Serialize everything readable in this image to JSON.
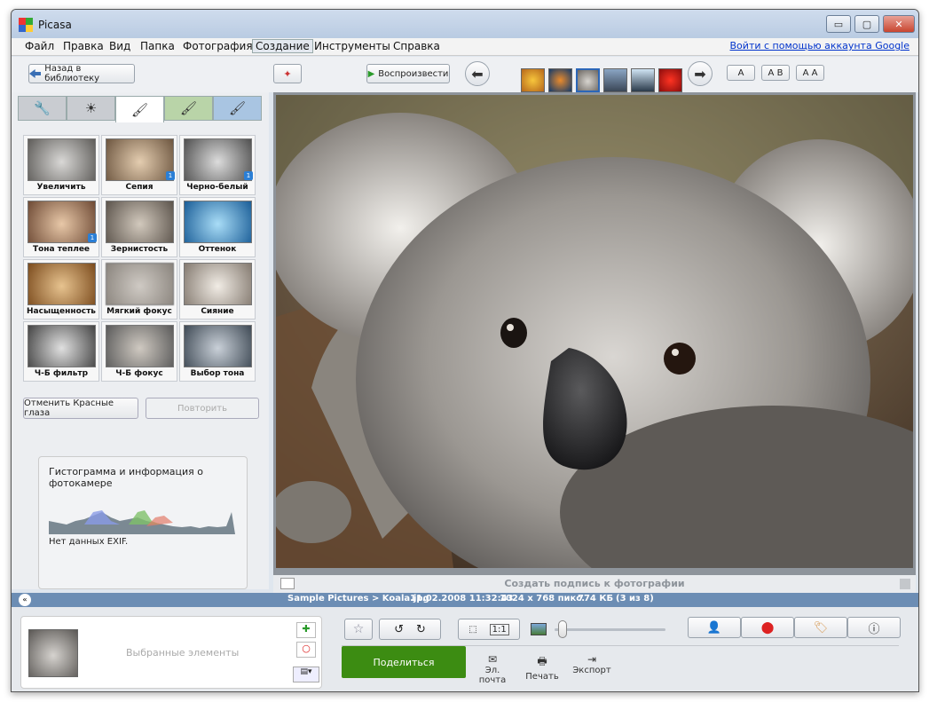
{
  "window": {
    "title": "Picasa",
    "minimize": "▭",
    "maximize": "▢",
    "close": "✕"
  },
  "menu": {
    "items": [
      "Файл",
      "Правка",
      "Вид",
      "Папка",
      "Фотография",
      "Создание",
      "Инструменты",
      "Справка"
    ],
    "active_index": 5,
    "signin": "Войти с помощью аккаунта Google"
  },
  "toolbar": {
    "back": "Назад в библиотеку",
    "play": "Воспроизвести",
    "text_buttons": [
      "A",
      "A B",
      "A A"
    ]
  },
  "tabs": {
    "icons": [
      "wrench-icon",
      "sun-icon",
      "brush-icon",
      "green-brush-icon",
      "blue-brush-icon"
    ],
    "glyphs": [
      "🔧",
      "☀",
      "🖌",
      "🖌",
      "🖌"
    ],
    "active_index": 2
  },
  "effects": [
    {
      "label": "Увеличить резкость",
      "badge": ""
    },
    {
      "label": "Сепия",
      "badge": "1"
    },
    {
      "label": "Черно-белый",
      "badge": "1"
    },
    {
      "label": "Тона теплее",
      "badge": "1"
    },
    {
      "label": "Зернистость",
      "badge": ""
    },
    {
      "label": "Оттенок",
      "badge": ""
    },
    {
      "label": "Насыщенность",
      "badge": ""
    },
    {
      "label": "Мягкий фокус",
      "badge": ""
    },
    {
      "label": "Сияние",
      "badge": ""
    },
    {
      "label": "Ч-Б фильтр",
      "badge": ""
    },
    {
      "label": "Ч-Б фокус",
      "badge": ""
    },
    {
      "label": "Выбор тона",
      "badge": ""
    }
  ],
  "actions": {
    "undo": "Отменить Красные глаза",
    "redo": "Повторить"
  },
  "histogram": {
    "title": "Гистограмма и информация о фотокамере",
    "exif": "Нет данных EXIF."
  },
  "caption": {
    "placeholder": "Создать подпись к фотографии"
  },
  "status": {
    "path": "Sample Pictures > Koala.jpg",
    "date": "11.02.2008 11:32:43",
    "size": "1024 x 768 пикс.",
    "filesize": "774 КБ",
    "position": "(3 из 8)"
  },
  "tray": {
    "label": "Выбранные элементы"
  },
  "bottom": {
    "share": "Поделиться",
    "email": "Эл. почта",
    "print": "Печать",
    "export": "Экспорт",
    "zoom_fit": "1:1"
  },
  "colors": {
    "accent": "#6c8db4",
    "share": "#3c8c12"
  }
}
